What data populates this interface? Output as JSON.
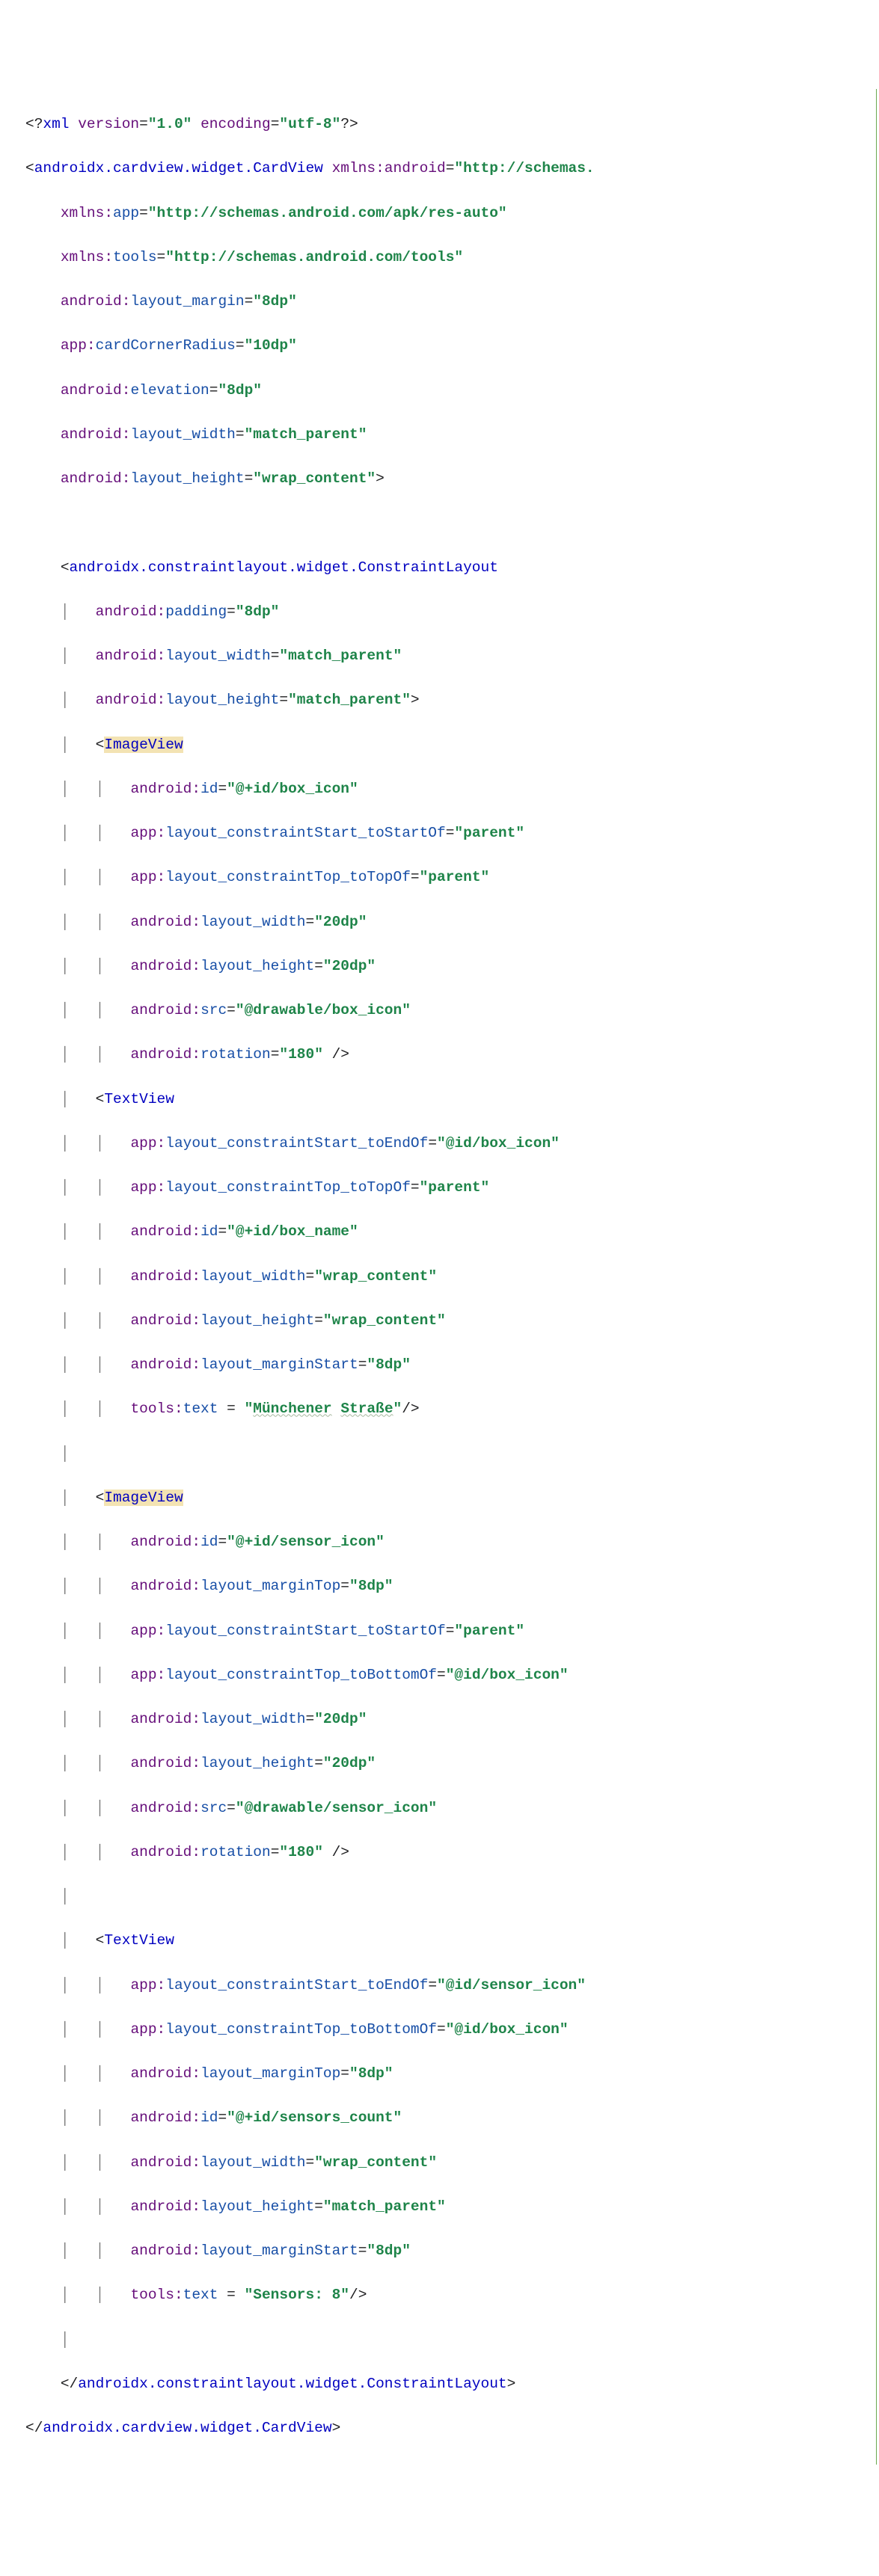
{
  "xml_decl": {
    "open": "<?",
    "xml": "xml",
    "v_attr": "version",
    "v_val": "\"1.0\"",
    "e_attr": "encoding",
    "e_val": "\"utf-8\"",
    "close": "?>"
  },
  "card": {
    "open": "<",
    "name": "androidx.cardview.widget.CardView",
    "xmlns_android_attr": "xmlns:android",
    "xmlns_android_val": "\"http://schemas.",
    "xmlns_app_p": "xmlns:",
    "xmlns_app_n": "app",
    "xmlns_app_val": "\"http://schemas.android.com/apk/res-auto\"",
    "xmlns_tools_p": "xmlns:",
    "xmlns_tools_n": "tools",
    "xmlns_tools_val": "\"http://schemas.android.com/tools\"",
    "a1_p": "android:",
    "a1_n": "layout_margin",
    "a1_v": "\"8dp\"",
    "a2_p": "app:",
    "a2_n": "cardCornerRadius",
    "a2_v": "\"10dp\"",
    "a3_p": "android:",
    "a3_n": "elevation",
    "a3_v": "\"8dp\"",
    "a4_p": "android:",
    "a4_n": "layout_width",
    "a4_v": "\"match_parent\"",
    "a5_p": "android:",
    "a5_n": "layout_height",
    "a5_v": "\"wrap_content\"",
    "close_name": "androidx.cardview.widget.CardView"
  },
  "cl": {
    "open": "<",
    "name": "androidx.constraintlayout.widget.ConstraintLayout",
    "a1_p": "android:",
    "a1_n": "padding",
    "a1_v": "\"8dp\"",
    "a2_p": "android:",
    "a2_n": "layout_width",
    "a2_v": "\"match_parent\"",
    "a3_p": "android:",
    "a3_n": "layout_height",
    "a3_v": "\"match_parent\"",
    "close_name": "androidx.constraintlayout.widget.ConstraintLayout"
  },
  "iv1": {
    "name": "ImageView",
    "a1_p": "android:",
    "a1_n": "id",
    "a1_v": "\"@+id/box_icon\"",
    "a2_p": "app:",
    "a2_n": "layout_constraintStart_toStartOf",
    "a2_v": "\"parent\"",
    "a3_p": "app:",
    "a3_n": "layout_constraintTop_toTopOf",
    "a3_v": "\"parent\"",
    "a4_p": "android:",
    "a4_n": "layout_width",
    "a4_v": "\"20dp\"",
    "a5_p": "android:",
    "a5_n": "layout_height",
    "a5_v": "\"20dp\"",
    "a6_p": "android:",
    "a6_n": "src",
    "a6_v": "\"@drawable/box_icon\"",
    "a7_p": "android:",
    "a7_n": "rotation",
    "a7_v": "\"180\""
  },
  "tv1": {
    "name": "TextView",
    "a1_p": "app:",
    "a1_n": "layout_constraintStart_toEndOf",
    "a1_v": "\"@id/box_icon\"",
    "a2_p": "app:",
    "a2_n": "layout_constraintTop_toTopOf",
    "a2_v": "\"parent\"",
    "a3_p": "android:",
    "a3_n": "id",
    "a3_v": "\"@+id/box_name\"",
    "a4_p": "android:",
    "a4_n": "layout_width",
    "a4_v": "\"wrap_content\"",
    "a5_p": "android:",
    "a5_n": "layout_height",
    "a5_v": "\"wrap_content\"",
    "a6_p": "android:",
    "a6_n": "layout_marginStart",
    "a6_v": "\"8dp\"",
    "a7_p": "tools:",
    "a7_n": "text",
    "a7_eq": " = ",
    "a7_vq": "\"",
    "a7_w1": "Münchener",
    "a7_sp": " ",
    "a7_w2": "Straße",
    "a7_vq2": "\""
  },
  "iv2": {
    "name": "ImageView",
    "a1_p": "android:",
    "a1_n": "id",
    "a1_v": "\"@+id/sensor_icon\"",
    "a2_p": "android:",
    "a2_n": "layout_marginTop",
    "a2_v": "\"8dp\"",
    "a3_p": "app:",
    "a3_n": "layout_constraintStart_toStartOf",
    "a3_v": "\"parent\"",
    "a4_p": "app:",
    "a4_n": "layout_constraintTop_toBottomOf",
    "a4_v": "\"@id/box_icon\"",
    "a5_p": "android:",
    "a5_n": "layout_width",
    "a5_v": "\"20dp\"",
    "a6_p": "android:",
    "a6_n": "layout_height",
    "a6_v": "\"20dp\"",
    "a7_p": "android:",
    "a7_n": "src",
    "a7_v": "\"@drawable/sensor_icon\"",
    "a8_p": "android:",
    "a8_n": "rotation",
    "a8_v": "\"180\""
  },
  "tv2": {
    "name": "TextView",
    "a1_p": "app:",
    "a1_n": "layout_constraintStart_toEndOf",
    "a1_v": "\"@id/sensor_icon\"",
    "a2_p": "app:",
    "a2_n": "layout_constraintTop_toBottomOf",
    "a2_v": "\"@id/box_icon\"",
    "a3_p": "android:",
    "a3_n": "layout_marginTop",
    "a3_v": "\"8dp\"",
    "a4_p": "android:",
    "a4_n": "id",
    "a4_v": "\"@+id/sensors_count\"",
    "a5_p": "android:",
    "a5_n": "layout_width",
    "a5_v": "\"wrap_content\"",
    "a6_p": "android:",
    "a6_n": "layout_height",
    "a6_v": "\"match_parent\"",
    "a7_p": "android:",
    "a7_n": "layout_marginStart",
    "a7_v": "\"8dp\"",
    "a8_p": "tools:",
    "a8_n": "text",
    "a8_eq": " = ",
    "a8_v": "\"Sensors: 8\""
  },
  "sym": {
    "gt": ">",
    "sgt": "/>",
    "sp_sgt": " />",
    "lts": "</",
    "eq": "="
  }
}
